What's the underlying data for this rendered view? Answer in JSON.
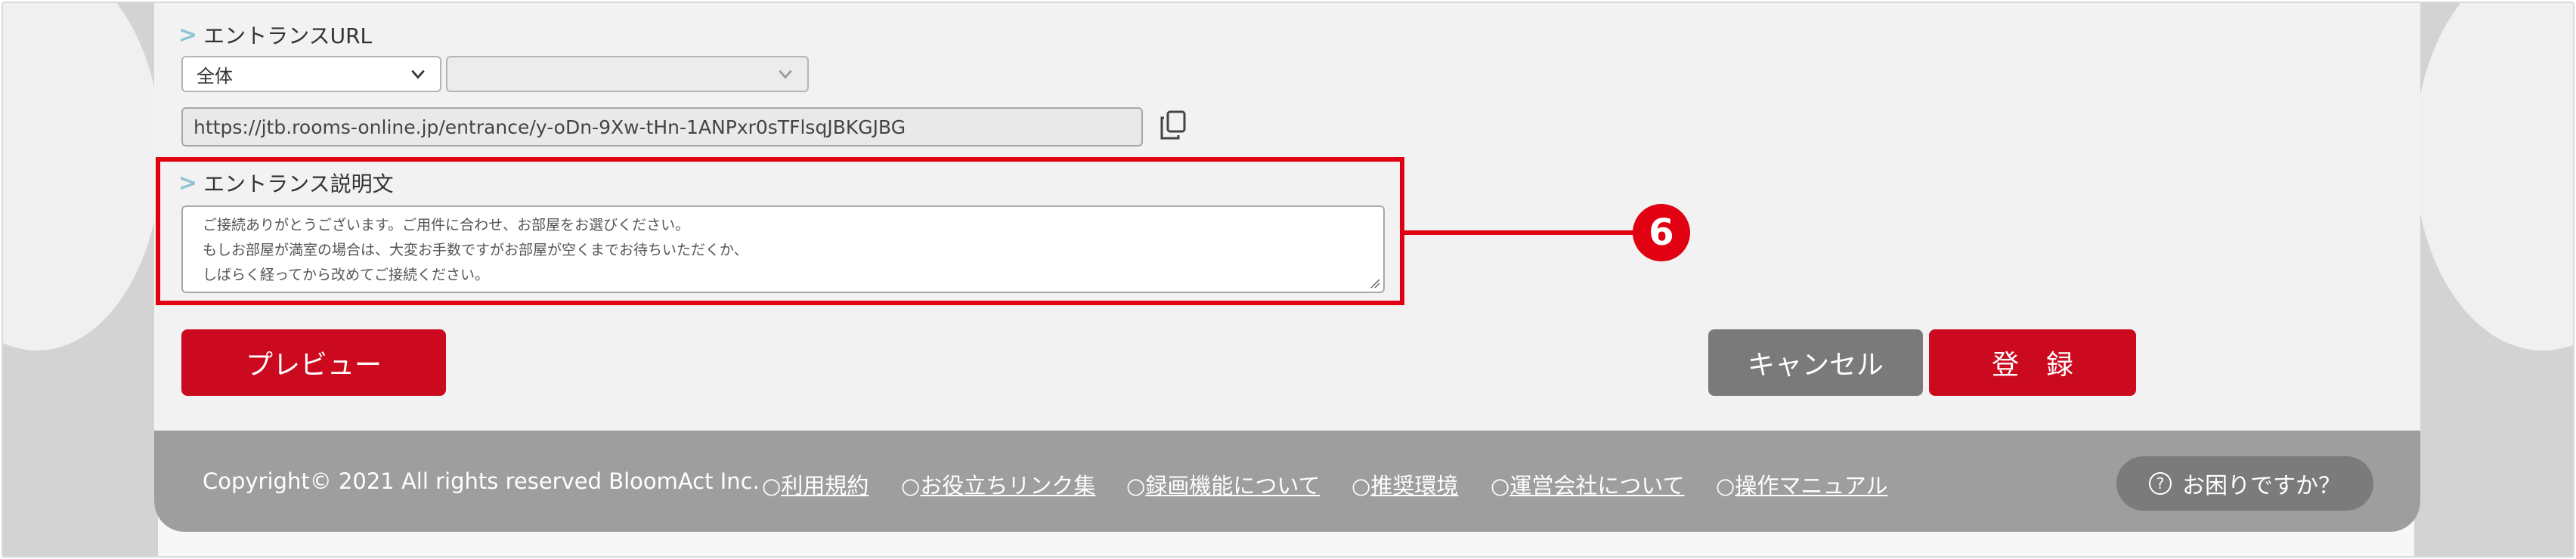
{
  "entrance_url": {
    "label": "エントランスURL",
    "scope_select": "全体",
    "room_select": "",
    "url_value": "https://jtb.rooms-online.jp/entrance/y-oDn-9Xw-tHn-1ANPxr0sTFlsqJBKGJBG",
    "copy_icon": "copy-icon"
  },
  "entrance_description": {
    "label": "エントランス説明文",
    "lines": [
      "ご接続ありがとうございます。ご用件に合わせ、お部屋をお選びください。",
      "もしお部屋が満室の場合は、大変お手数ですがお部屋が空くまでお待ちいただくか、",
      "しばらく経ってから改めてご接続ください。"
    ]
  },
  "callout": {
    "number": "6",
    "color": "#e00012"
  },
  "buttons": {
    "preview": "プレビュー",
    "cancel": "キャンセル",
    "register": "登　録"
  },
  "footer": {
    "copyright": "Copyright© 2021 All rights reserved BloomAct Inc.",
    "links": [
      {
        "bullet": "○",
        "label": "利用規約"
      },
      {
        "bullet": "○",
        "label": "お役立ちリンク集"
      },
      {
        "bullet": "○",
        "label": "録画機能について"
      },
      {
        "bullet": "○",
        "label": "推奨環境"
      },
      {
        "bullet": "○",
        "label": "運営会社について"
      },
      {
        "bullet": "○",
        "label": "操作マニュアル"
      }
    ],
    "help": {
      "icon": "question-icon",
      "label": "お困りですか？"
    }
  },
  "colors": {
    "accent_red": "#cc0a1f",
    "gray_button": "#7a7a7a",
    "footer_bg": "#9e9e9e"
  }
}
